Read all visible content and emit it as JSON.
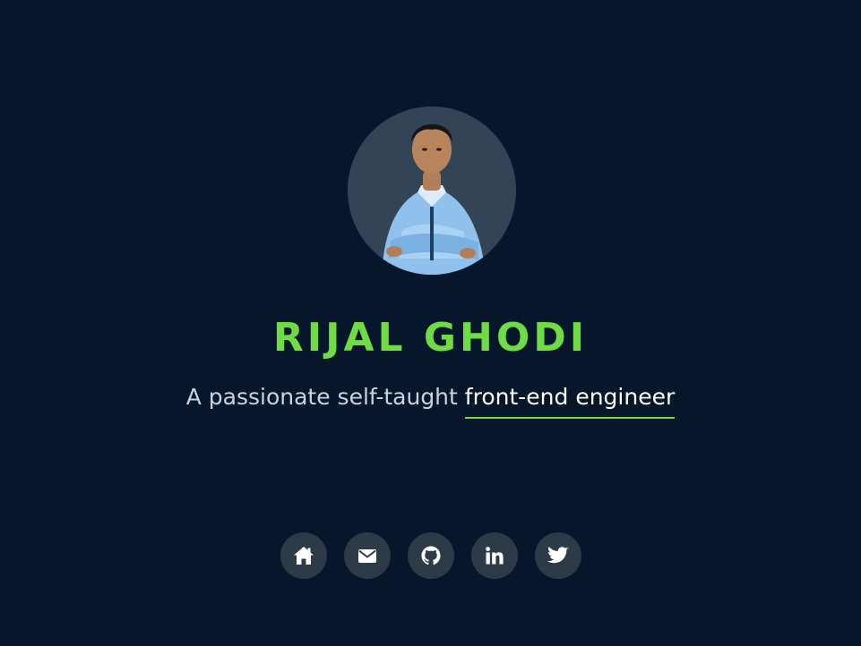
{
  "profile": {
    "name": "RIJAL GHODI",
    "tagline_prefix": "A passionate self-taught",
    "tagline_highlight": "front-end engineer"
  },
  "social_links": [
    {
      "label": "Home",
      "icon": "home-icon"
    },
    {
      "label": "Email",
      "icon": "mail-icon"
    },
    {
      "label": "GitHub",
      "icon": "github-icon"
    },
    {
      "label": "LinkedIn",
      "icon": "linkedin-icon"
    },
    {
      "label": "Twitter",
      "icon": "twitter-icon"
    }
  ],
  "colors": {
    "background": "#06172b",
    "accent": "#6fdc45",
    "icon_background": "#2d3a48",
    "icon_color": "#ffffff"
  }
}
